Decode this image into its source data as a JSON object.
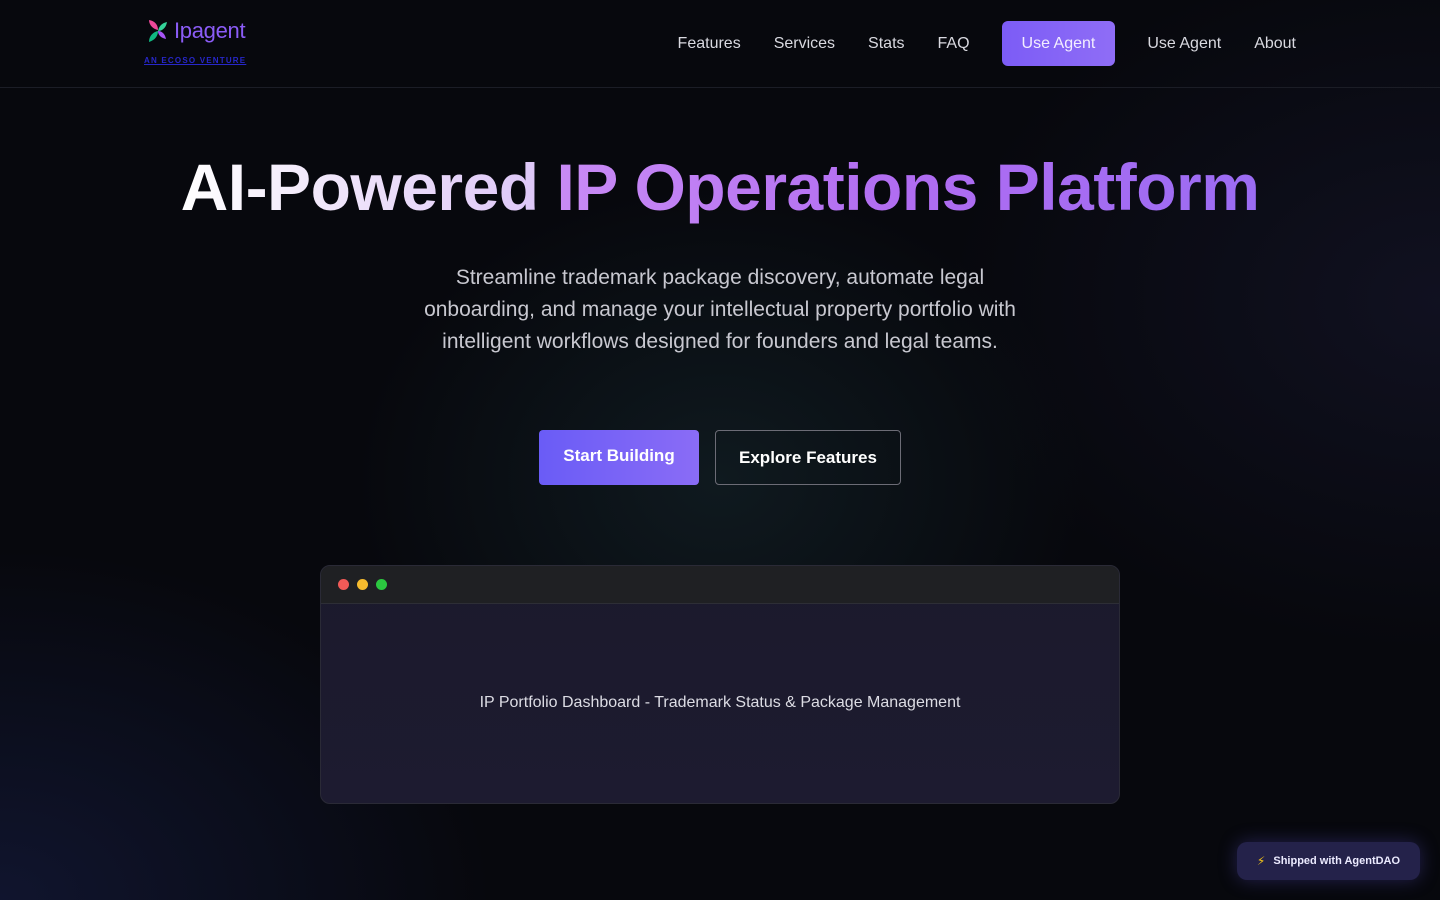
{
  "brand": {
    "name": "Ipagent",
    "tagline": "AN ECOSO VENTURE",
    "icon": "leaf-mark-icon",
    "accent": "#8b5cf6"
  },
  "nav": {
    "links": [
      "Features",
      "Services",
      "Stats",
      "FAQ"
    ],
    "cta_label": "Use Agent",
    "after_links": [
      "Use Agent",
      "About"
    ]
  },
  "hero": {
    "title_part1": "AI-Powered ",
    "title_part2": "IP Operations Platform",
    "subtitle": "Streamline trademark package discovery, automate legal onboarding, and manage your intellectual property portfolio with intelligent workflows designed for founders and legal teams.",
    "primary_button": "Start Building",
    "secondary_button": "Explore Features"
  },
  "preview": {
    "caption": "IP Portfolio Dashboard - Trademark Status & Package Management",
    "dots": [
      "#f05a57",
      "#f5bb2e",
      "#2bc840"
    ]
  },
  "badge": {
    "icon": "lightning-icon",
    "label": "Shipped with AgentDAO"
  }
}
